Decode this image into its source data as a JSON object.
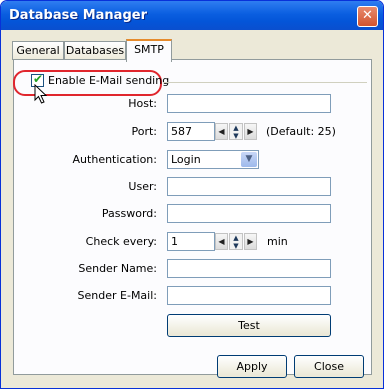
{
  "window": {
    "title": "Database Manager",
    "close_symbol": "✕"
  },
  "tabs": [
    {
      "label": "General"
    },
    {
      "label": "Databases"
    },
    {
      "label": "SMTP"
    }
  ],
  "smtp": {
    "enable_label": "Enable E-Mail sending",
    "enabled": true,
    "host": {
      "label": "Host:",
      "value": ""
    },
    "port": {
      "label": "Port:",
      "value": "587",
      "hint": "(Default: 25)"
    },
    "authentication": {
      "label": "Authentication:",
      "value": "Login"
    },
    "user": {
      "label": "User:",
      "value": ""
    },
    "password": {
      "label": "Password:",
      "value": ""
    },
    "check_every": {
      "label": "Check every:",
      "value": "1",
      "unit": "min"
    },
    "sender_name": {
      "label": "Sender Name:",
      "value": ""
    },
    "sender_email": {
      "label": "Sender E-Mail:",
      "value": ""
    },
    "test_label": "Test"
  },
  "footer": {
    "apply_label": "Apply",
    "close_label": "Close"
  },
  "icons": {
    "spin_left": "◀",
    "spin_right": "▶",
    "spin_up": "▲",
    "spin_down": "▼",
    "dropdown": "▼"
  }
}
